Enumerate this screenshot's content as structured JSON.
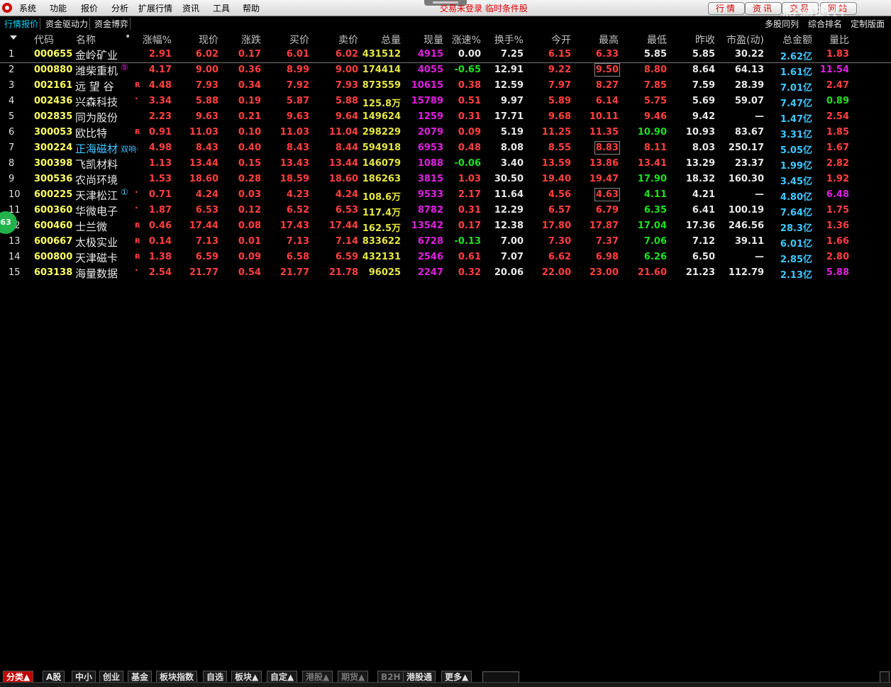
{
  "menu": {
    "items": [
      "系统",
      "功能",
      "报价",
      "分析",
      "扩展行情",
      "资讯",
      "工具",
      "帮助"
    ],
    "notice": "交易未登录  临时条件股",
    "buttons": [
      "行情",
      "资讯",
      "交易",
      "网站"
    ],
    "watermark": "股海明灯"
  },
  "tabs": {
    "left": [
      "行情报价",
      "资金驱动力",
      "资金博弈"
    ],
    "right": [
      "多股同列",
      "综合排名",
      "定制版面"
    ]
  },
  "columns": [
    "代码",
    "名称",
    "涨幅%",
    "现价",
    "涨跌",
    "买价",
    "卖价",
    "总量",
    "现量",
    "涨速%",
    "换手%",
    "今开",
    "最高",
    "最低",
    "昨收",
    "市盈(动)",
    "总金额",
    "量比"
  ],
  "badge": "63",
  "rows": [
    {
      "i": "1",
      "code": "000655",
      "name": "金岭矿业",
      "flag": "",
      "sup": "",
      "pct": "2.91",
      "price": "6.02",
      "chg": "0.17",
      "bid": "6.01",
      "ask": "6.02",
      "vol": "431512",
      "cur": "4915",
      "spd": "0.00",
      "turn": "7.25",
      "open": "6.15",
      "high": "6.33",
      "low": "5.85",
      "prev": "5.85",
      "pe": "30.22",
      "amt": "2.62亿",
      "ratio": "1.83"
    },
    {
      "i": "2",
      "code": "000880",
      "name": "潍柴重机",
      "flag": "",
      "sup": "⑤",
      "pct": "4.17",
      "price": "9.00",
      "chg": "0.36",
      "bid": "8.99",
      "ask": "9.00",
      "vol": "174414",
      "cur": "4055",
      "spd": "-0.65",
      "turn": "12.91",
      "open": "9.22",
      "high": "9.50",
      "low": "8.80",
      "prev": "8.64",
      "pe": "64.13",
      "amt": "1.61亿",
      "ratio": "11.54"
    },
    {
      "i": "3",
      "code": "002161",
      "name": "远 望 谷",
      "flag": "R",
      "sup": "",
      "pct": "4.48",
      "price": "7.93",
      "chg": "0.34",
      "bid": "7.92",
      "ask": "7.93",
      "vol": "873559",
      "cur": "10615",
      "spd": "0.38",
      "turn": "12.59",
      "open": "7.97",
      "high": "8.27",
      "low": "7.85",
      "prev": "7.59",
      "pe": "28.39",
      "amt": "7.01亿",
      "ratio": "2.47"
    },
    {
      "i": "4",
      "code": "002436",
      "name": "兴森科技",
      "flag": "·",
      "sup": "",
      "pct": "3.34",
      "price": "5.88",
      "chg": "0.19",
      "bid": "5.87",
      "ask": "5.88",
      "vol": "125.8万",
      "cur": "15789",
      "spd": "0.51",
      "turn": "9.97",
      "open": "5.89",
      "high": "6.14",
      "low": "5.75",
      "prev": "5.69",
      "pe": "59.07",
      "amt": "7.47亿",
      "ratio": "0.89"
    },
    {
      "i": "5",
      "code": "002835",
      "name": "同为股份",
      "flag": "",
      "sup": "",
      "pct": "2.23",
      "price": "9.63",
      "chg": "0.21",
      "bid": "9.63",
      "ask": "9.64",
      "vol": "149624",
      "cur": "1259",
      "spd": "0.31",
      "turn": "17.71",
      "open": "9.68",
      "high": "10.11",
      "low": "9.46",
      "prev": "9.42",
      "pe": "—",
      "amt": "1.47亿",
      "ratio": "2.54"
    },
    {
      "i": "6",
      "code": "300053",
      "name": "欧比特",
      "flag": "R",
      "sup": "",
      "pct": "0.91",
      "price": "11.03",
      "chg": "0.10",
      "bid": "11.03",
      "ask": "11.04",
      "vol": "298229",
      "cur": "2079",
      "spd": "0.09",
      "turn": "5.19",
      "open": "11.25",
      "high": "11.35",
      "low": "10.90",
      "prev": "10.93",
      "pe": "83.67",
      "amt": "3.31亿",
      "ratio": "1.85"
    },
    {
      "i": "7",
      "code": "300224",
      "name": "正海磁材",
      "flag": "",
      "sup": "双响·",
      "pct": "4.98",
      "price": "8.43",
      "chg": "0.40",
      "bid": "8.43",
      "ask": "8.44",
      "vol": "594918",
      "cur": "6953",
      "spd": "0.48",
      "turn": "8.08",
      "open": "8.55",
      "high": "8.83",
      "low": "8.11",
      "prev": "8.03",
      "pe": "250.17",
      "amt": "5.05亿",
      "ratio": "1.67"
    },
    {
      "i": "8",
      "code": "300398",
      "name": "飞凯材料",
      "flag": "",
      "sup": "",
      "pct": "1.13",
      "price": "13.44",
      "chg": "0.15",
      "bid": "13.43",
      "ask": "13.44",
      "vol": "146079",
      "cur": "1088",
      "spd": "-0.06",
      "turn": "3.40",
      "open": "13.59",
      "high": "13.86",
      "low": "13.41",
      "prev": "13.29",
      "pe": "23.37",
      "amt": "1.99亿",
      "ratio": "2.82"
    },
    {
      "i": "9",
      "code": "300536",
      "name": "农尚环境",
      "flag": "",
      "sup": "",
      "pct": "1.53",
      "price": "18.60",
      "chg": "0.28",
      "bid": "18.59",
      "ask": "18.60",
      "vol": "186263",
      "cur": "3815",
      "spd": "1.03",
      "turn": "30.50",
      "open": "19.40",
      "high": "19.47",
      "low": "17.90",
      "prev": "18.32",
      "pe": "160.30",
      "amt": "3.45亿",
      "ratio": "1.92"
    },
    {
      "i": "10",
      "code": "600225",
      "name": "天津松江",
      "flag": "·",
      "sup": "①",
      "pct": "0.71",
      "price": "4.24",
      "chg": "0.03",
      "bid": "4.23",
      "ask": "4.24",
      "vol": "108.6万",
      "cur": "9533",
      "spd": "2.17",
      "turn": "11.64",
      "open": "4.56",
      "high": "4.63",
      "low": "4.11",
      "prev": "4.21",
      "pe": "—",
      "amt": "4.80亿",
      "ratio": "6.48"
    },
    {
      "i": "11",
      "code": "600360",
      "name": "华微电子",
      "flag": "·",
      "sup": "",
      "pct": "1.87",
      "price": "6.53",
      "chg": "0.12",
      "bid": "6.52",
      "ask": "6.53",
      "vol": "117.4万",
      "cur": "8782",
      "spd": "0.31",
      "turn": "12.29",
      "open": "6.57",
      "high": "6.79",
      "low": "6.35",
      "prev": "6.41",
      "pe": "100.19",
      "amt": "7.64亿",
      "ratio": "1.75"
    },
    {
      "i": "12",
      "code": "600460",
      "name": "士兰微",
      "flag": "R",
      "sup": "",
      "pct": "0.46",
      "price": "17.44",
      "chg": "0.08",
      "bid": "17.43",
      "ask": "17.44",
      "vol": "162.5万",
      "cur": "13542",
      "spd": "0.17",
      "turn": "12.38",
      "open": "17.80",
      "high": "17.87",
      "low": "17.04",
      "prev": "17.36",
      "pe": "246.56",
      "amt": "28.3亿",
      "ratio": "1.36"
    },
    {
      "i": "13",
      "code": "600667",
      "name": "太极实业",
      "flag": "R",
      "sup": "",
      "pct": "0.14",
      "price": "7.13",
      "chg": "0.01",
      "bid": "7.13",
      "ask": "7.14",
      "vol": "833622",
      "cur": "6728",
      "spd": "-0.13",
      "turn": "7.00",
      "open": "7.30",
      "high": "7.37",
      "low": "7.06",
      "prev": "7.12",
      "pe": "39.11",
      "amt": "6.01亿",
      "ratio": "1.66"
    },
    {
      "i": "14",
      "code": "600800",
      "name": "天津磁卡",
      "flag": "R",
      "sup": "",
      "pct": "1.38",
      "price": "6.59",
      "chg": "0.09",
      "bid": "6.58",
      "ask": "6.59",
      "vol": "432131",
      "cur": "2546",
      "spd": "0.61",
      "turn": "7.07",
      "open": "6.62",
      "high": "6.98",
      "low": "6.26",
      "prev": "6.50",
      "pe": "—",
      "amt": "2.85亿",
      "ratio": "2.80"
    },
    {
      "i": "15",
      "code": "603138",
      "name": "海量数据",
      "flag": "·",
      "sup": "",
      "pct": "2.54",
      "price": "21.77",
      "chg": "0.54",
      "bid": "21.77",
      "ask": "21.78",
      "vol": "96025",
      "cur": "2247",
      "spd": "0.32",
      "turn": "20.06",
      "open": "22.00",
      "high": "23.00",
      "low": "21.60",
      "prev": "21.23",
      "pe": "112.79",
      "amt": "2.13亿",
      "ratio": "5.88"
    }
  ],
  "bottom_tabs": [
    "分类▲",
    "A股",
    "中小",
    "创业",
    "基金",
    "板块指数",
    "自选",
    "板块▲",
    "自定▲",
    "港股▲",
    "期货▲",
    "B2H",
    "港股通",
    "更多▲"
  ]
}
